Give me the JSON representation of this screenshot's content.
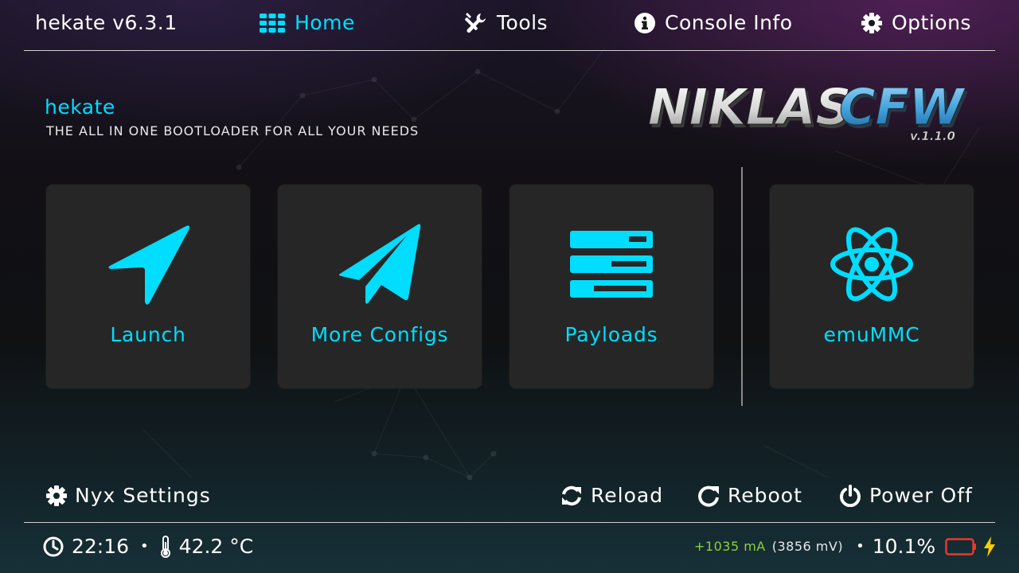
{
  "header": {
    "version": "hekate v6.3.1",
    "tabs": [
      {
        "label": "Home",
        "icon": "grid-icon"
      },
      {
        "label": "Tools",
        "icon": "tools-icon"
      },
      {
        "label": "Console Info",
        "icon": "info-icon"
      },
      {
        "label": "Options",
        "icon": "gear-icon"
      }
    ]
  },
  "brand": {
    "title": "hekate",
    "subtitle": "THE ALL IN ONE BOOTLOADER FOR ALL YOUR NEEDS",
    "logo_text_a": "NIKLAS",
    "logo_text_b": "CFW",
    "logo_version": "v.1.1.0"
  },
  "tiles": [
    {
      "label": "Launch",
      "icon": "navigation-arrow-icon"
    },
    {
      "label": "More Configs",
      "icon": "paper-plane-icon"
    },
    {
      "label": "Payloads",
      "icon": "server-stack-icon"
    },
    {
      "label": "emuMMC",
      "icon": "atom-icon"
    }
  ],
  "footer": {
    "nyx_settings": "Nyx Settings",
    "reload": "Reload",
    "reboot": "Reboot",
    "power_off": "Power Off"
  },
  "status": {
    "time": "22:16",
    "bullet": "•",
    "temperature": "42.2 °C",
    "current": "+1035 mA",
    "voltage": "(3856 mV)",
    "battery_percent": "10.1%"
  },
  "colors": {
    "accent": "#00ddff",
    "tile_bg": "#262626",
    "current_text": "#8bd13a",
    "battery_low": "#e53a2e",
    "charging_bolt": "#f5d000"
  }
}
